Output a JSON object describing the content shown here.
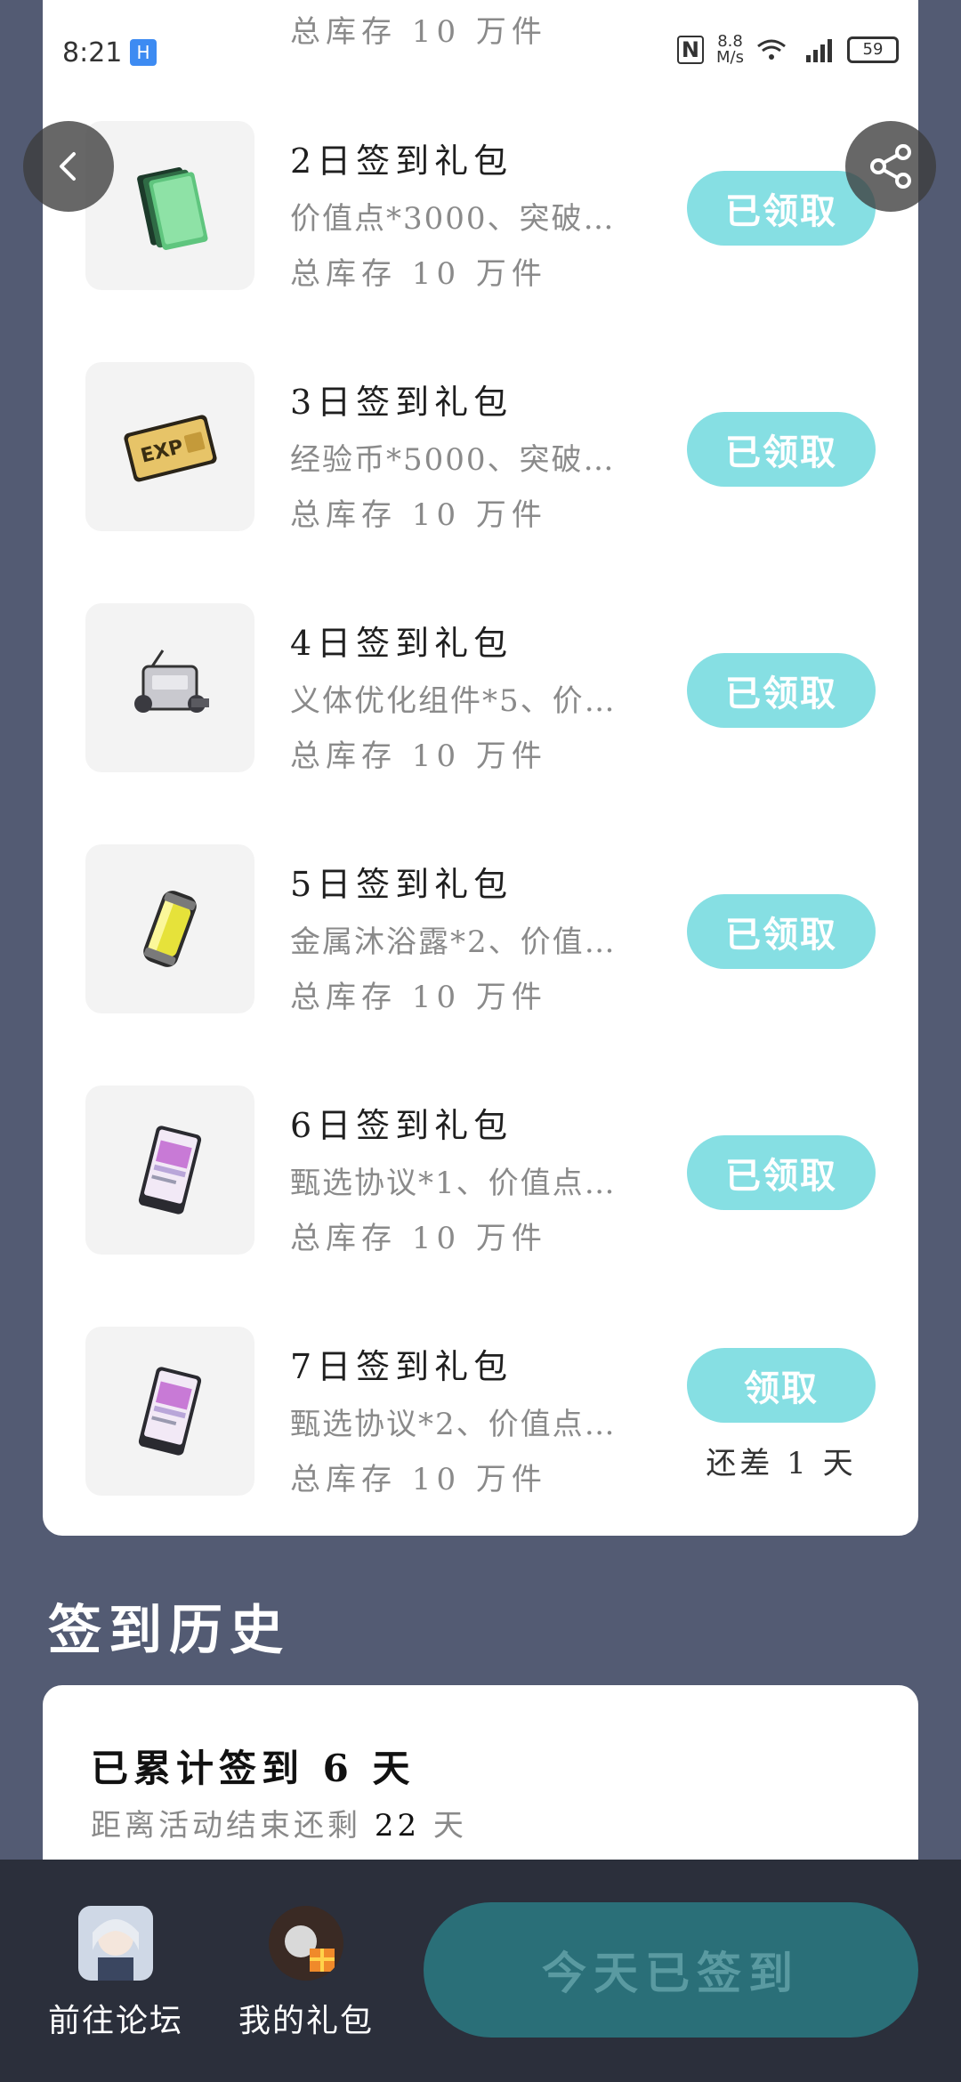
{
  "status_bar": {
    "time": "8:21",
    "hd_label": "H",
    "nfc_label": "N",
    "speed_value": "8.8",
    "speed_unit": "M/s",
    "battery": "59"
  },
  "gifts": [
    {
      "title": "2日签到礼包",
      "desc": "价值点*3000、突破…",
      "stock": "总库存 10 万件",
      "button": "已领取",
      "icon": "green-cards-icon"
    },
    {
      "title": "3日签到礼包",
      "desc": "经验币*5000、突破…",
      "stock": "总库存 10 万件",
      "button": "已领取",
      "icon": "exp-card-icon"
    },
    {
      "title": "4日签到礼包",
      "desc": "义体优化组件*5、价…",
      "stock": "总库存 10 万件",
      "button": "已领取",
      "icon": "component-kit-icon"
    },
    {
      "title": "5日签到礼包",
      "desc": "金属沐浴露*2、价值…",
      "stock": "总库存 10 万件",
      "button": "已领取",
      "icon": "canister-icon"
    },
    {
      "title": "6日签到礼包",
      "desc": "甄选协议*1、价值点…",
      "stock": "总库存 10 万件",
      "button": "已领取",
      "icon": "protocol-card-icon"
    },
    {
      "title": "7日签到礼包",
      "desc": "甄选协议*2、价值点…",
      "stock": "总库存 10 万件",
      "button": "领取",
      "remain": "还差 1 天",
      "icon": "protocol-card-icon"
    }
  ],
  "partial_top_stock": "总库存 10 万件",
  "history": {
    "section_title": "签到历史",
    "count_text": "已累计签到 6 天",
    "end_prefix": "距离活动结束还剩",
    "end_days": "22",
    "end_suffix": "天"
  },
  "bottom_bar": {
    "forum_label": "前往论坛",
    "gift_label": "我的礼包",
    "checkin_label": "今天已签到"
  },
  "colors": {
    "background": "#535b73",
    "button_claimed": "#86dfe3",
    "checkin_button": "#2a6f78",
    "bottom_bar": "#2b2f3b"
  }
}
